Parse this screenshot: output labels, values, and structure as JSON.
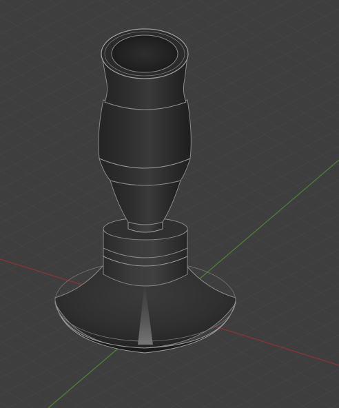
{
  "viewport": {
    "background": "#3e3e3e",
    "grid_minor_color": "#474747",
    "grid_major_color": "#4f4f4f",
    "axis_x_color": "#8a3535",
    "axis_y_color": "#4f7f35",
    "object": "candlestick"
  }
}
